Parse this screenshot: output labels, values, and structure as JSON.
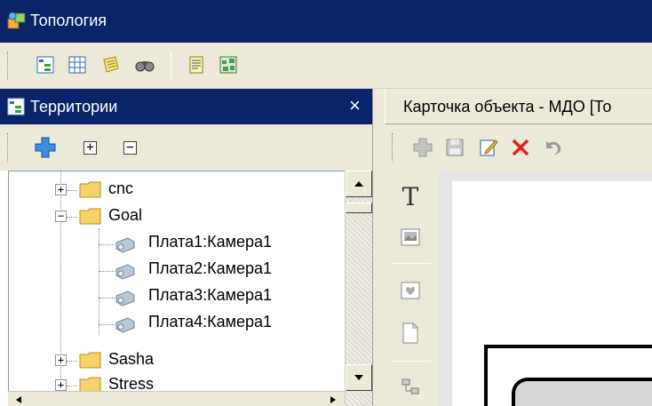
{
  "window": {
    "title": "Топология",
    "icon": "topology-app-icon"
  },
  "main_toolbar": {
    "buttons": [
      {
        "name": "tree-view-icon"
      },
      {
        "name": "grid-view-icon"
      },
      {
        "name": "notes-icon"
      },
      {
        "name": "binoculars-icon"
      },
      {
        "name": "document-list-icon"
      },
      {
        "name": "map-icon"
      }
    ]
  },
  "left_panel": {
    "title": "Территории",
    "close": "×",
    "toolbar": {
      "add_icon": "add-cross-icon",
      "expand_all": "+",
      "collapse_all": "−"
    },
    "tree": [
      {
        "label": "cnc",
        "type": "folder",
        "expander": "+",
        "level": 0
      },
      {
        "label": "Goal",
        "type": "folder",
        "expander": "−",
        "level": 0
      },
      {
        "label": "Плата1:Камера1",
        "type": "camera",
        "level": 1
      },
      {
        "label": "Плата2:Камера1",
        "type": "camera",
        "level": 1
      },
      {
        "label": "Плата3:Камера1",
        "type": "camera",
        "level": 1
      },
      {
        "label": "Плата4:Камера1",
        "type": "camera",
        "level": 1
      },
      {
        "label": "Sasha",
        "type": "folder",
        "expander": "+",
        "level": 0
      },
      {
        "label": "Stress",
        "type": "folder",
        "expander": "+",
        "level": 0
      }
    ]
  },
  "right_panel": {
    "title": "Карточка объекта - МДО [То",
    "toolbar": {
      "buttons": [
        {
          "name": "add-icon"
        },
        {
          "name": "save-icon"
        },
        {
          "name": "edit-icon"
        },
        {
          "name": "delete-icon"
        },
        {
          "name": "undo-icon"
        }
      ]
    },
    "side_tools": [
      {
        "name": "text-tool-icon",
        "glyph": "T"
      },
      {
        "name": "image-tool-icon"
      },
      {
        "name": "shape-tool-icon"
      },
      {
        "name": "page-tool-icon"
      },
      {
        "name": "connector-tool-icon"
      }
    ]
  },
  "colors": {
    "titlebar": "#0a246a",
    "chrome": "#ece9d8",
    "folder": "#f5d36a",
    "delete_red": "#e02020"
  }
}
